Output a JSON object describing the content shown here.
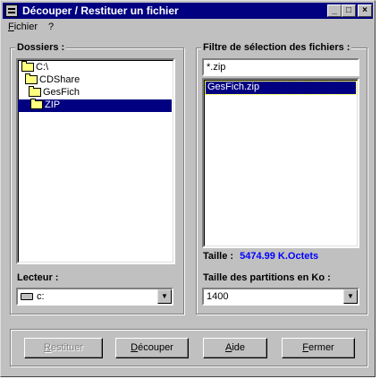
{
  "window": {
    "title": "Découper / Restituer un fichier",
    "controls": {
      "minimize": "_",
      "maximize": "□",
      "close": "×"
    }
  },
  "menu": {
    "items": [
      {
        "label_first": "F",
        "label_rest": "ichier"
      },
      {
        "label_first": "",
        "label_rest": "?"
      }
    ]
  },
  "folders": {
    "label": "Dossiers :",
    "items": [
      {
        "label": "C:\\"
      },
      {
        "label": "CDShare"
      },
      {
        "label": "GesFich"
      },
      {
        "label": "ZIP",
        "selected": true
      }
    ]
  },
  "drive": {
    "label": "Lecteur :",
    "value": "c:"
  },
  "filter": {
    "label": "Filtre de sélection des fichiers :",
    "value": "*.zip",
    "files": [
      {
        "label": "GesFich.zip",
        "selected": true
      }
    ],
    "size_label": "Taille :",
    "size_value": "5474.99 K.Octets",
    "size_color": "#0000ff"
  },
  "partition": {
    "label": "Taille des partitions en Ko :",
    "value": "1400"
  },
  "buttons": {
    "restore": {
      "first": "R",
      "rest": "estituer",
      "enabled": false
    },
    "split": {
      "first": "D",
      "rest": "écouper",
      "enabled": true
    },
    "help": {
      "first": "A",
      "rest": "ide",
      "enabled": true
    },
    "close": {
      "first": "F",
      "rest": "ermer",
      "enabled": true
    }
  },
  "colors": {
    "titlebar": "#000080",
    "face": "#c0c0c0",
    "selection": "#000080"
  }
}
